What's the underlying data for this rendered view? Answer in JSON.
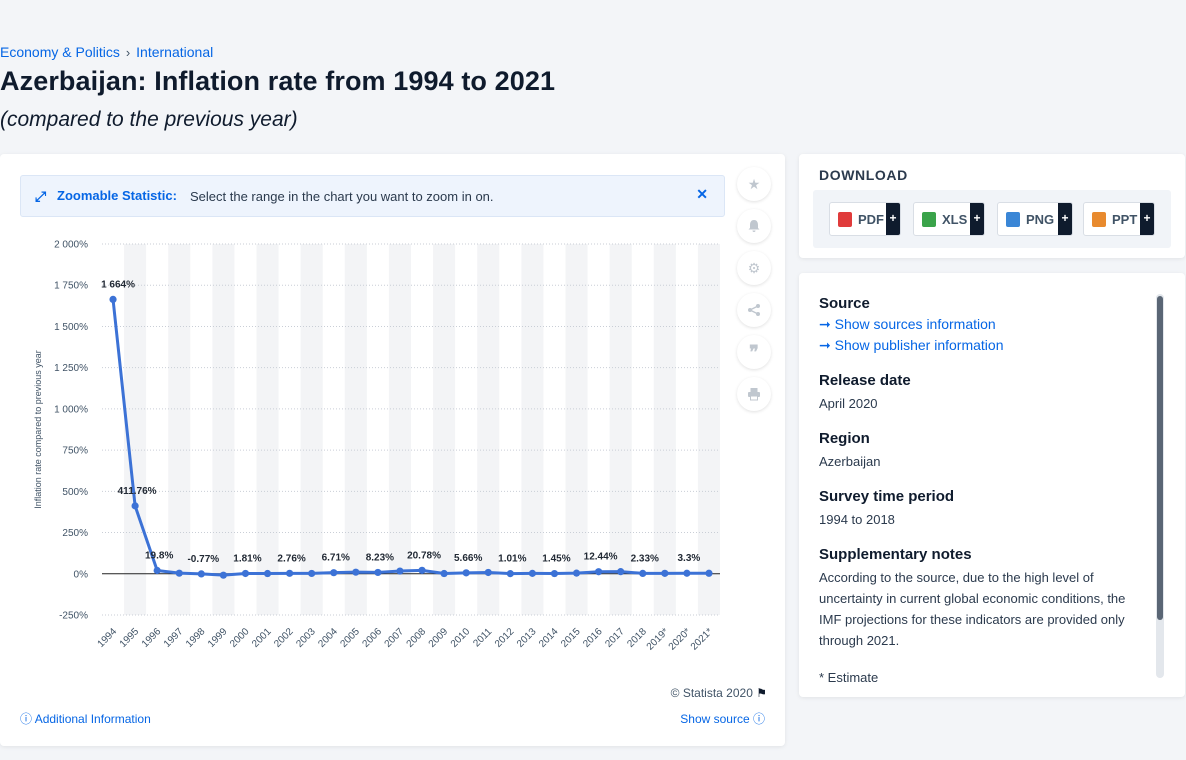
{
  "breadcrumb": [
    "Economy & Politics",
    "International"
  ],
  "title": "Azerbaijan: Inflation rate from 1994 to 2021",
  "subtitle": "(compared to the previous year)",
  "zoom": {
    "title": "Zoomable Statistic:",
    "text": "Select the range in the chart you want to zoom in on."
  },
  "credit": "© Statista 2020",
  "footer": {
    "additional": "Additional Information",
    "show_source": "Show source"
  },
  "download": {
    "title": "DOWNLOAD",
    "buttons": [
      {
        "label": "PDF",
        "color": "#e03b3b"
      },
      {
        "label": "XLS",
        "color": "#3aa34a"
      },
      {
        "label": "PNG",
        "color": "#3a86d6"
      },
      {
        "label": "PPT",
        "color": "#e88a2e"
      }
    ],
    "plus": "+"
  },
  "info": {
    "source_label": "Source",
    "source_link": "Show sources information",
    "publisher_link": "Show publisher information",
    "release_label": "Release date",
    "release_value": "April 2020",
    "region_label": "Region",
    "region_value": "Azerbaijan",
    "period_label": "Survey time period",
    "period_value": "1994 to 2018",
    "notes_label": "Supplementary notes",
    "notes_value": "According to the source, due to the high level of uncertainty in current global economic conditions, the IMF projections for these indicators are provided only through 2021.",
    "estimate_note": "* Estimate"
  },
  "colors": {
    "accent": "#0666e5",
    "series": "#3c72d6",
    "text": "#0f1b2d"
  },
  "chart_data": {
    "type": "line",
    "x": [
      "1994",
      "1995",
      "1996",
      "1997",
      "1998",
      "1999",
      "2000",
      "2001",
      "2002",
      "2003",
      "2004",
      "2005",
      "2006",
      "2007",
      "2008",
      "2009",
      "2010",
      "2011",
      "2012",
      "2013",
      "2014",
      "2015",
      "2016",
      "2017",
      "2018",
      "2019*",
      "2020*",
      "2021*"
    ],
    "values": [
      1664,
      411.76,
      19.8,
      3.7,
      -0.77,
      -8.5,
      1.81,
      1.5,
      2.76,
      2.2,
      6.71,
      9.7,
      8.23,
      16.6,
      20.78,
      1.5,
      5.66,
      7.9,
      1.01,
      2.4,
      1.45,
      4.0,
      12.44,
      12.9,
      2.33,
      2.6,
      3.3,
      3.0
    ],
    "data_labels": [
      {
        "index": 0,
        "text": "1 664%"
      },
      {
        "index": 1,
        "text": "411.76%"
      },
      {
        "index": 2,
        "text": "19.8%"
      },
      {
        "index": 4,
        "text": "-0.77%"
      },
      {
        "index": 6,
        "text": "1.81%"
      },
      {
        "index": 8,
        "text": "2.76%"
      },
      {
        "index": 10,
        "text": "6.71%"
      },
      {
        "index": 12,
        "text": "8.23%"
      },
      {
        "index": 14,
        "text": "20.78%"
      },
      {
        "index": 16,
        "text": "5.66%"
      },
      {
        "index": 18,
        "text": "1.01%"
      },
      {
        "index": 20,
        "text": "1.45%"
      },
      {
        "index": 22,
        "text": "12.44%"
      },
      {
        "index": 24,
        "text": "2.33%"
      },
      {
        "index": 26,
        "text": "3.3%"
      }
    ],
    "yticks": [
      2000,
      1750,
      1500,
      1250,
      1000,
      750,
      500,
      250,
      0,
      -250
    ],
    "ytick_labels": [
      "2 000%",
      "1 750%",
      "1 500%",
      "1 250%",
      "1 000%",
      "750%",
      "500%",
      "250%",
      "0%",
      "-250%"
    ],
    "ylim": [
      -250,
      2000
    ],
    "ylabel": "Inflation rate compared to previous year",
    "xlabel": "",
    "grid": true
  }
}
